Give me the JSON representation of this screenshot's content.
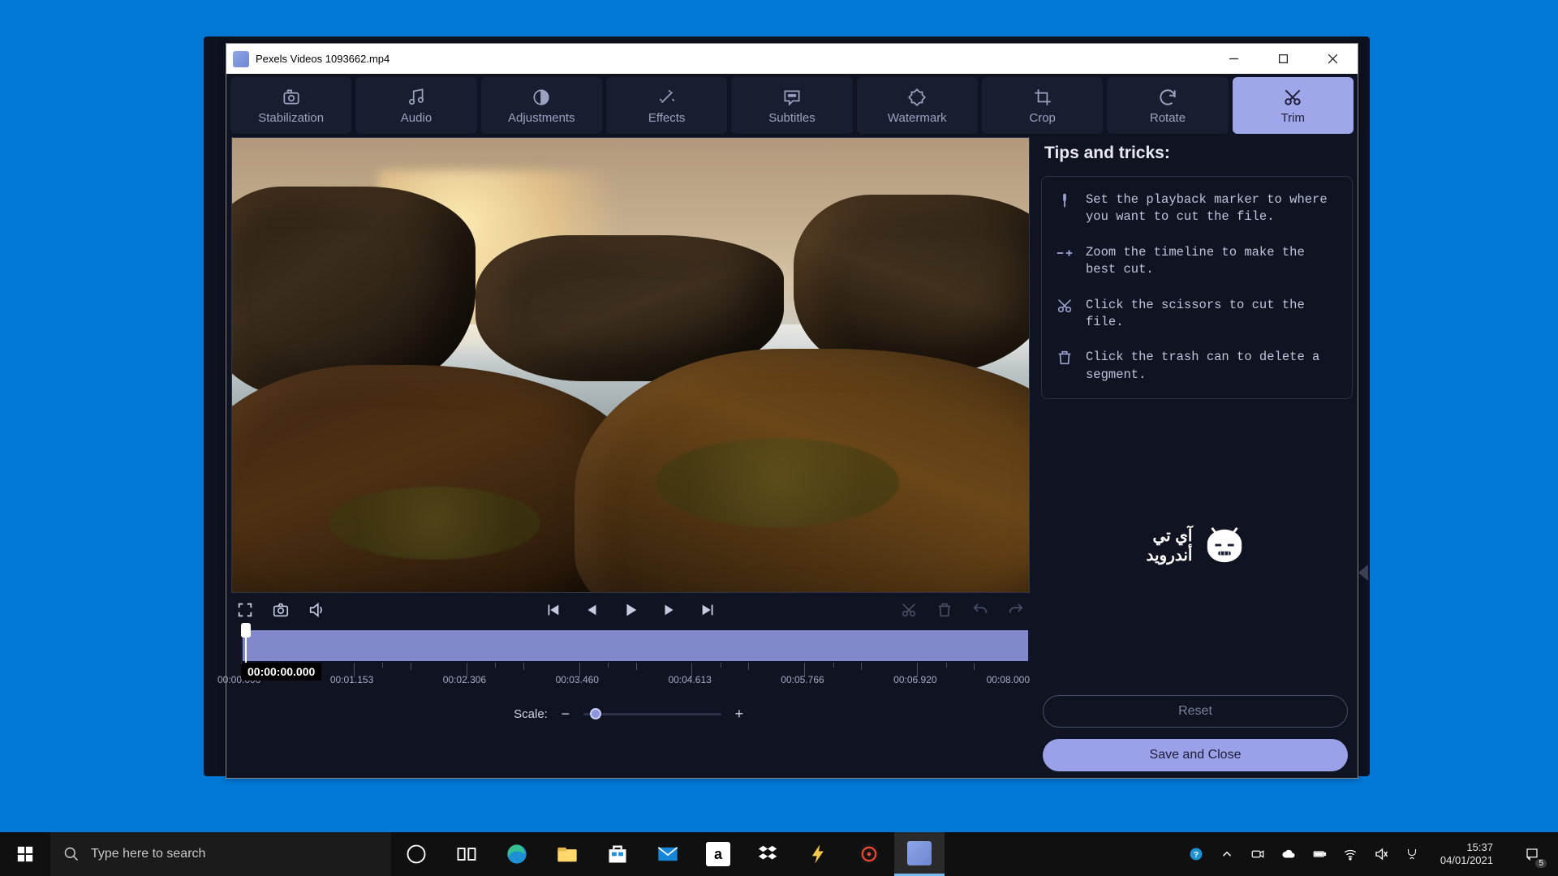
{
  "window": {
    "title": "Pexels Videos 1093662.mp4"
  },
  "toolbar": [
    {
      "id": "stabilization",
      "label": "Stabilization"
    },
    {
      "id": "audio",
      "label": "Audio"
    },
    {
      "id": "adjustments",
      "label": "Adjustments"
    },
    {
      "id": "effects",
      "label": "Effects"
    },
    {
      "id": "subtitles",
      "label": "Subtitles"
    },
    {
      "id": "watermark",
      "label": "Watermark"
    },
    {
      "id": "crop",
      "label": "Crop"
    },
    {
      "id": "rotate",
      "label": "Rotate"
    },
    {
      "id": "trim",
      "label": "Trim",
      "active": true
    }
  ],
  "tips": {
    "title": "Tips and tricks:",
    "items": [
      "Set the playback marker to where you want to cut the file.",
      "Zoom the timeline to make the best cut.",
      "Click the scissors to cut the file.",
      "Click the trash can to delete a segment."
    ]
  },
  "timeline": {
    "current": "00:00:00.000",
    "marks": [
      "00:00.000",
      "00:01.153",
      "00:02.306",
      "00:03.460",
      "00:04.613",
      "00:05.766",
      "00:06.920",
      "00:08.000"
    ],
    "scale_label": "Scale:"
  },
  "buttons": {
    "reset": "Reset",
    "save": "Save and Close"
  },
  "logo": {
    "line1": "آي تي",
    "line2": "أندرويد"
  },
  "taskbar": {
    "search_placeholder": "Type here to search",
    "time": "15:37",
    "date": "04/01/2021",
    "notif_count": "5"
  }
}
